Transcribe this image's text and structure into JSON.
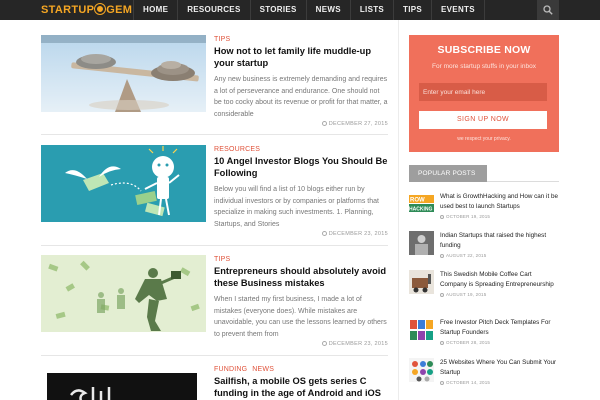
{
  "logo": {
    "text_left": "STARTUP",
    "text_right": "GEM"
  },
  "nav": {
    "items": [
      "HOME",
      "RESOURCES",
      "STORIES",
      "NEWS",
      "LISTS",
      "TIPS",
      "EVENTS"
    ]
  },
  "icons": {
    "search": "search-icon",
    "clock": "clock-icon"
  },
  "colors": {
    "accent": "#e0533b",
    "subscribe_bg": "#f0705b",
    "navbar_bg": "#262626",
    "logo": "#f5a623"
  },
  "articles": [
    {
      "categories": [
        "TIPS"
      ],
      "title": "How not to let family life muddle-up your startup",
      "excerpt": "Any new business is extremely demanding and requires a lot of perseverance and endurance. One should not be too cocky about its revenue or profit for that matter, a considerable",
      "date": "DECEMBER 27, 2015"
    },
    {
      "categories": [
        "RESOURCES"
      ],
      "title": "10 Angel Investor Blogs You Should Be Following",
      "excerpt": "Below you will find a list of 10 blogs either run by individual investors or by companies or platforms that specialize in making such investments. 1. Planning, Startups, and Stories",
      "date": "DECEMBER 23, 2015"
    },
    {
      "categories": [
        "TIPS"
      ],
      "title": "Entrepreneurs should absolutely avoid these Business mistakes",
      "excerpt": "When I started my first business, I made a lot of mistakes (everyone does). While mistakes are unavoidable, you can use the lessons learned by others to prevent them from",
      "date": "DECEMBER 23, 2015"
    },
    {
      "categories": [
        "FUNDING",
        "NEWS"
      ],
      "title": "Sailfish, a mobile OS gets series C funding in the age of Android and iOS"
    }
  ],
  "subscribe": {
    "title": "SUBSCRIBE NOW",
    "description": "For more startup stuffs in your inbox",
    "placeholder": "Enter your email here",
    "button": "SIGN UP NOW",
    "note": "we respect your privacy."
  },
  "popular": {
    "heading": "POPULAR POSTS",
    "items": [
      {
        "title": "What is GrowthHacking and How can it be used best to launch Startups",
        "date": "OCTOBER 19, 2015"
      },
      {
        "title": "Indian Startups that raised the highest funding",
        "date": "AUGUST 22, 2015"
      },
      {
        "title": "This Swedish Mobile Coffee Cart Company is Spreading Entrepreneurship",
        "date": "AUGUST 19, 2015"
      },
      {
        "title": "Free Investor Pitch Deck Templates For Startup Founders",
        "date": "OCTOBER 28, 2015"
      },
      {
        "title": "25 Websites Where You Can Submit Your Startup",
        "date": "OCTOBER 14, 2015"
      }
    ],
    "thumb_text": {
      "growth": "ROW",
      "hacking": "HACKING"
    }
  }
}
